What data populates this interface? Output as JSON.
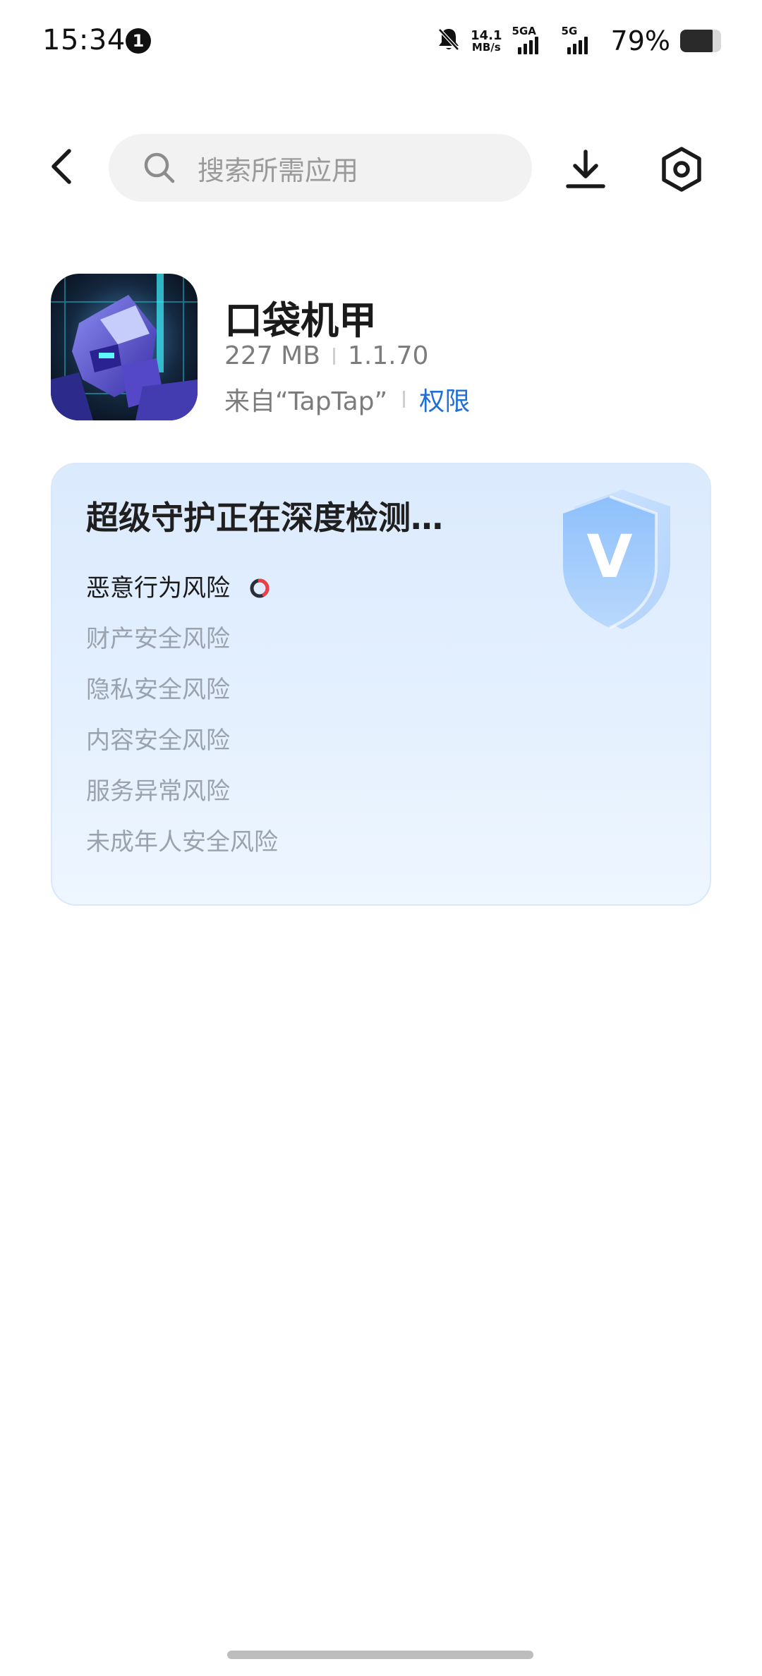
{
  "status_bar": {
    "time": "15:34",
    "notification_count": "1",
    "net_speed_value": "14.1",
    "net_speed_unit": "MB/s",
    "sim1_label": "5GA",
    "sim2_label": "5G",
    "battery_percent": "79%",
    "battery_level": 0.79
  },
  "top_nav": {
    "search_placeholder": "搜索所需应用"
  },
  "app": {
    "name": "口袋机甲",
    "size": "227 MB",
    "version": "1.1.70",
    "source": "来自“TapTap”",
    "permissions_label": "权限"
  },
  "scan_card": {
    "title": "超级守护正在深度检测…",
    "shield_letter": "V",
    "risks": [
      {
        "label": "恶意行为风险",
        "state": "scanning"
      },
      {
        "label": "财产安全风险",
        "state": "pending"
      },
      {
        "label": "隐私安全风险",
        "state": "pending"
      },
      {
        "label": "内容安全风险",
        "state": "pending"
      },
      {
        "label": "服务异常风险",
        "state": "pending"
      },
      {
        "label": "未成年人安全风险",
        "state": "pending"
      }
    ]
  },
  "colors": {
    "accent_blue": "#1f6fd6",
    "card_bg": "#dbeafd",
    "spinner_red": "#e8414a"
  },
  "icons": [
    "back-arrow-icon",
    "search-icon",
    "download-icon",
    "settings-hex-icon",
    "shield-icon",
    "spinner-icon",
    "bell-off-icon",
    "signal-icon",
    "battery-icon"
  ]
}
